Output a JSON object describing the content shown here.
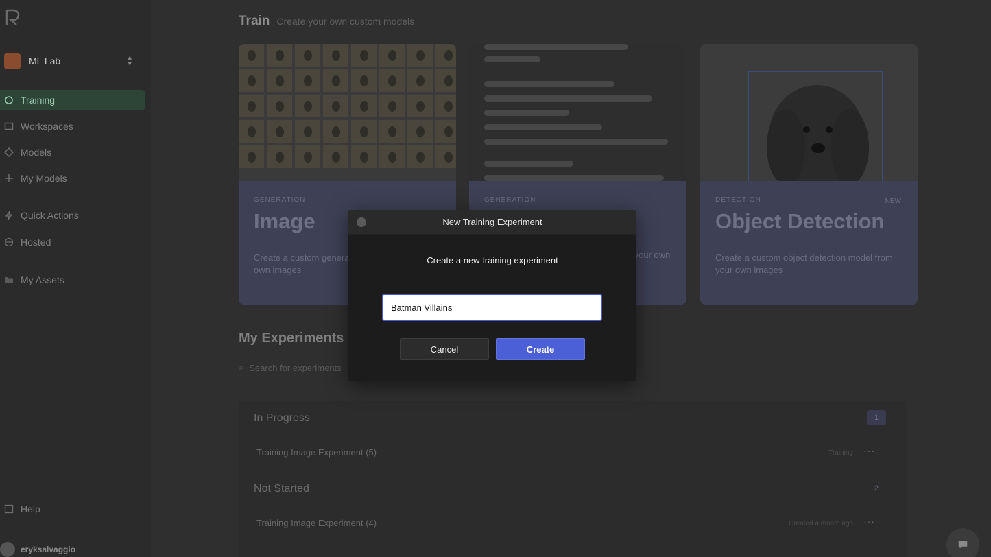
{
  "sidebar": {
    "workspace_name": "ML Lab",
    "items": [
      {
        "label": "Training",
        "icon": "training-icon",
        "active": true
      },
      {
        "label": "Workspaces",
        "icon": "workspaces-icon"
      },
      {
        "label": "Models",
        "icon": "models-icon"
      },
      {
        "label": "My Models",
        "icon": "my-models-icon"
      },
      {
        "label": "Quick Actions",
        "icon": "quick-actions-icon"
      },
      {
        "label": "Hosted",
        "icon": "hosted-icon"
      },
      {
        "label": "My Assets",
        "icon": "folder-icon"
      },
      {
        "label": "Help",
        "icon": "help-icon"
      }
    ],
    "user": "eryksalvaggio"
  },
  "header": {
    "title": "Train",
    "subtitle": "Create your own custom models"
  },
  "cards": [
    {
      "kicker": "Generation",
      "title": "Image",
      "desc": "Create a custom generation model from your own images"
    },
    {
      "kicker": "Generation",
      "title": "",
      "desc": "model from your own text files"
    },
    {
      "kicker": "Detection",
      "title": "Object Detection",
      "badge": "NEW",
      "desc": "Create a custom object detection model from your own images"
    }
  ],
  "experiments": {
    "title": "My Experiments",
    "search_placeholder": "Search for experiments",
    "groups": [
      {
        "title": "In Progress",
        "count": "1",
        "rows": [
          {
            "name": "Training Image Experiment (5)",
            "meta": "Training"
          }
        ]
      },
      {
        "title": "Not Started",
        "count": "2",
        "rows": [
          {
            "name": "Training Image Experiment (4)",
            "meta": "Created a month ago"
          }
        ]
      }
    ]
  },
  "modal": {
    "title": "New Training Experiment",
    "prompt": "Create a new training experiment",
    "input_value": "Batman Villains",
    "cancel_label": "Cancel",
    "create_label": "Create"
  },
  "colors": {
    "accent": "#4b5fd6",
    "active_nav": "#2d4536",
    "modal_bg": "#1c1c1c"
  }
}
